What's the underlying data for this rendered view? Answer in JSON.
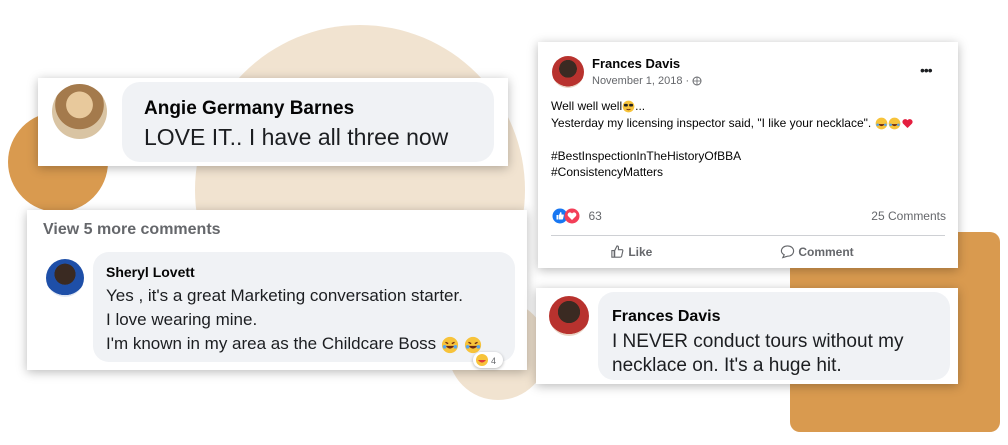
{
  "colors": {
    "beige": "#f1e3d0",
    "orange": "#d99a4f",
    "bubble": "#f0f2f5",
    "fb_blue": "#1877f2",
    "meta_gray": "#65676b"
  },
  "card1": {
    "author": "Angie Germany Barnes",
    "text": "LOVE IT.. I have all three now"
  },
  "card2": {
    "view_more": "View 5 more comments",
    "author": "Sheryl Lovett",
    "lines": [
      "Yes , it's a great Marketing conversation starter.",
      "I love wearing mine.",
      "I'm known in my area as the Childcare Boss"
    ],
    "reaction_icon": "laugh-emoji"
  },
  "post": {
    "author": "Frances Davis",
    "date": "November 1, 2018 ·",
    "audience_icon": "globe-icon",
    "more_icon": "•••",
    "line1": "Well well well",
    "line1_emoji": "sunglasses-emoji",
    "line1_suffix": "...",
    "line2": "Yesterday my licensing inspector said, \"I like your necklace\".",
    "line2_emoji": [
      "laugh-emoji",
      "laugh-emoji",
      "heart-emoji"
    ],
    "hashtag1": "#BestInspectionInTheHistoryOfBBA",
    "hashtag2": "#ConsistencyMatters",
    "reactions_count": "63",
    "comments_count": "25 Comments",
    "like_label": "Like",
    "comment_label": "Comment"
  },
  "card4": {
    "author": "Frances Davis",
    "line1": "I NEVER conduct tours without my",
    "line2": "necklace on. It's a huge hit."
  }
}
